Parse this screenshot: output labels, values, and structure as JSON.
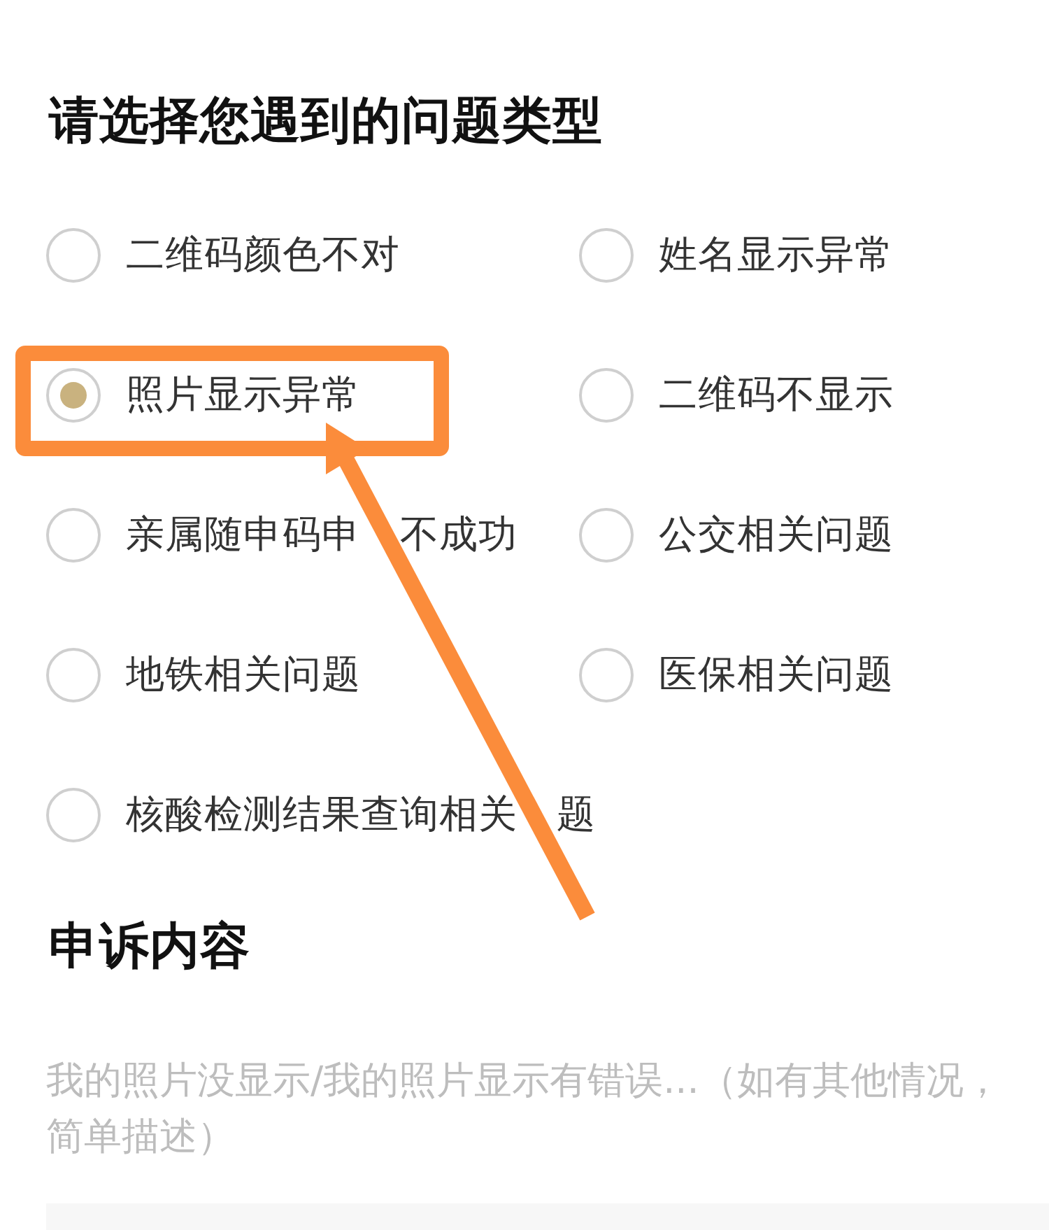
{
  "question": {
    "title": "请选择您遇到的问题类型",
    "options": [
      {
        "label": "二维码颜色不对",
        "selected": false
      },
      {
        "label": "姓名显示异常",
        "selected": false
      },
      {
        "label": "照片显示异常",
        "selected": true
      },
      {
        "label": "二维码不显示",
        "selected": false
      },
      {
        "label": "亲属随申码申　不成功",
        "selected": false
      },
      {
        "label": "公交相关问题",
        "selected": false
      },
      {
        "label": "地铁相关问题",
        "selected": false
      },
      {
        "label": "医保相关问题",
        "selected": false
      },
      {
        "label": "核酸检测结果查询相关　题",
        "selected": false
      }
    ]
  },
  "complaint": {
    "title": "申诉内容",
    "placeholder_lines": [
      "我的照片没显示/我的照片显示有错误...（如有其他情况，",
      "简单描述）"
    ]
  }
}
